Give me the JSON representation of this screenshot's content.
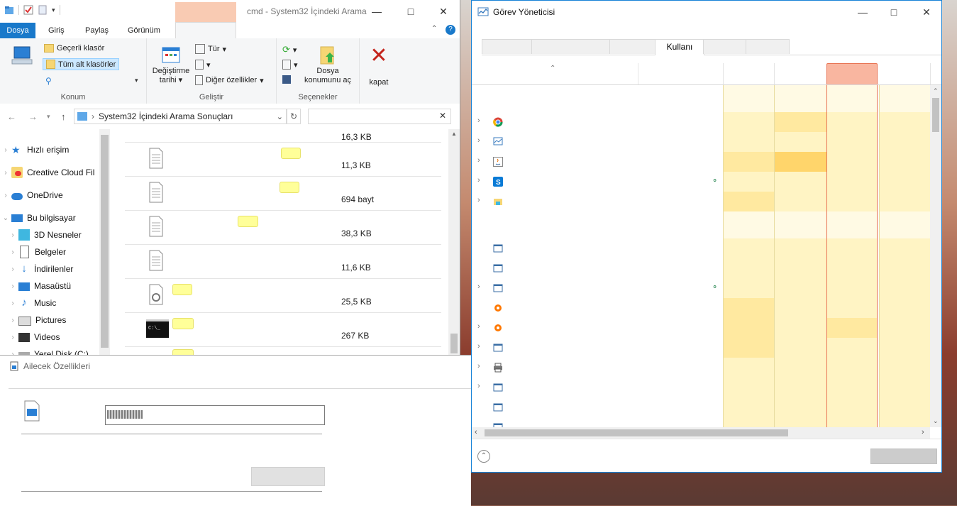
{
  "explorer": {
    "title": "cmd - System32 İçindeki Aramа",
    "tabs": {
      "file": "Dosya",
      "home": "Giriş",
      "share": "Paylaş",
      "view": "Görünüm"
    },
    "ribbon": {
      "current_folder": "Geçerli klasör",
      "all_subfolders": "Tüm alt klasörler",
      "group_location": "Konum",
      "date_modified_line1": "Değiştirme",
      "date_modified_line2": "tarihi",
      "type": "Tür",
      "other_properties": "Diğer özellikler",
      "group_refine": "Geliştir",
      "open_location_line1": "Dosya",
      "open_location_line2": "konumunu aç",
      "group_options": "Seçenekler",
      "close": "kapat"
    },
    "address": "System32 İçindeki Arama Sonuçları",
    "nav": {
      "quick_access": "Hızlı erişim",
      "creative_cloud": "Creative Cloud Fil",
      "onedrive": "OneDrive",
      "this_pc": "Bu bilgisayar",
      "objects3d": "3D Nesneler",
      "documents": "Belgeler",
      "downloads": "İndirilenler",
      "desktop": "Masaüstü",
      "music": "Music",
      "pictures": "Pictures",
      "videos": "Videos",
      "local_disk": "Yerel Disk (C:)"
    },
    "files": [
      {
        "size": "16,3 KB"
      },
      {
        "size": "11,3 KB"
      },
      {
        "size": "694 bayt"
      },
      {
        "size": "38,3 KB"
      },
      {
        "size": "11,6 KB"
      },
      {
        "size": "25,5 KB"
      },
      {
        "size": "267 KB"
      }
    ]
  },
  "properties": {
    "title": "Ailecek Özellikleri"
  },
  "taskmanager": {
    "title": "Görev Yöneticisi",
    "active_tab": "Kullanı"
  },
  "colors": {
    "accent": "#1979ca",
    "search_tab": "#f9cbb3",
    "selected_column": "#f9b6a0",
    "heat_low": "#fff4c4",
    "heat_mid": "#ffe9a0",
    "heat_high": "#ffd56b"
  }
}
